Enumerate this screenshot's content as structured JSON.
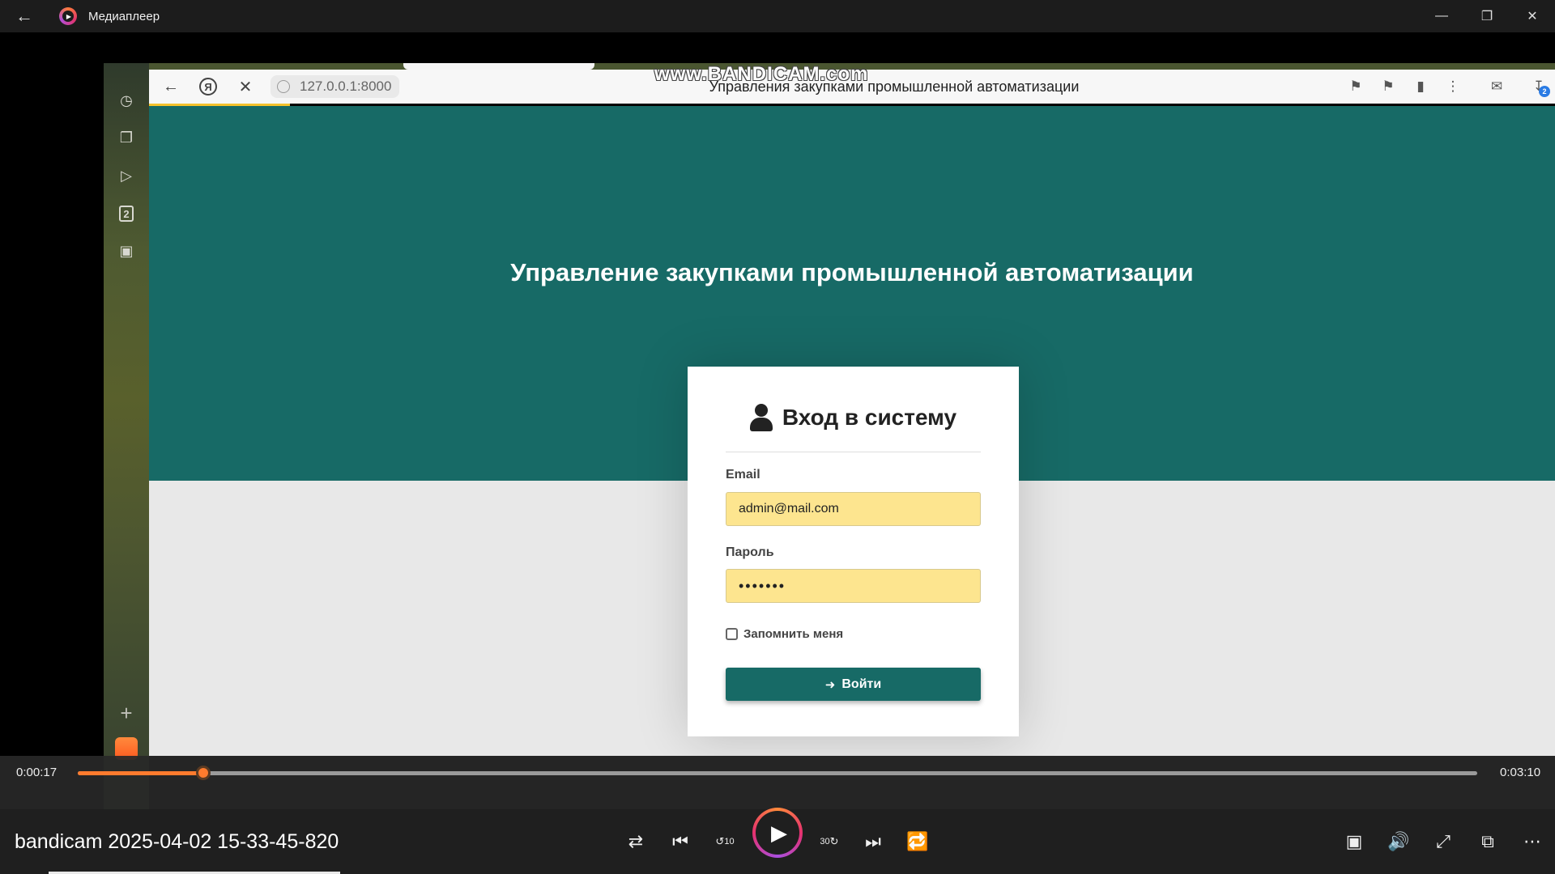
{
  "window": {
    "app_title": "Медиаплеер"
  },
  "browser": {
    "watermark": "www.BANDICAM.com",
    "url": "127.0.0.1:8000",
    "tab_title": "Управления закупками промышленной автоматизации",
    "downloads_count": "2",
    "sidebar_badge": "2"
  },
  "page": {
    "title": "Управление закупками промышленной автоматизации",
    "login": {
      "heading": "Вход в систему",
      "email_label": "Email",
      "email_value": "admin@mail.com",
      "password_label": "Пароль",
      "password_value": "•••••••",
      "remember_label": "Запомнить меня",
      "submit_label": "Войти"
    }
  },
  "player": {
    "current_time": "0:00:17",
    "total_time": "0:03:10",
    "progress_fraction": 0.0895,
    "file_name": "bandicam 2025-04-02 15-33-45-820",
    "skip_back_seconds": "10",
    "skip_forward_seconds": "30"
  },
  "colors": {
    "accent": "#ff7b2e",
    "page_primary": "#176a66",
    "autofill": "#fde58f"
  },
  "icons": {
    "back": "back-arrow-icon",
    "shuffle": "shuffle-icon",
    "previous": "previous-icon",
    "play": "play-icon",
    "next": "next-icon",
    "repeat": "repeat-icon"
  }
}
